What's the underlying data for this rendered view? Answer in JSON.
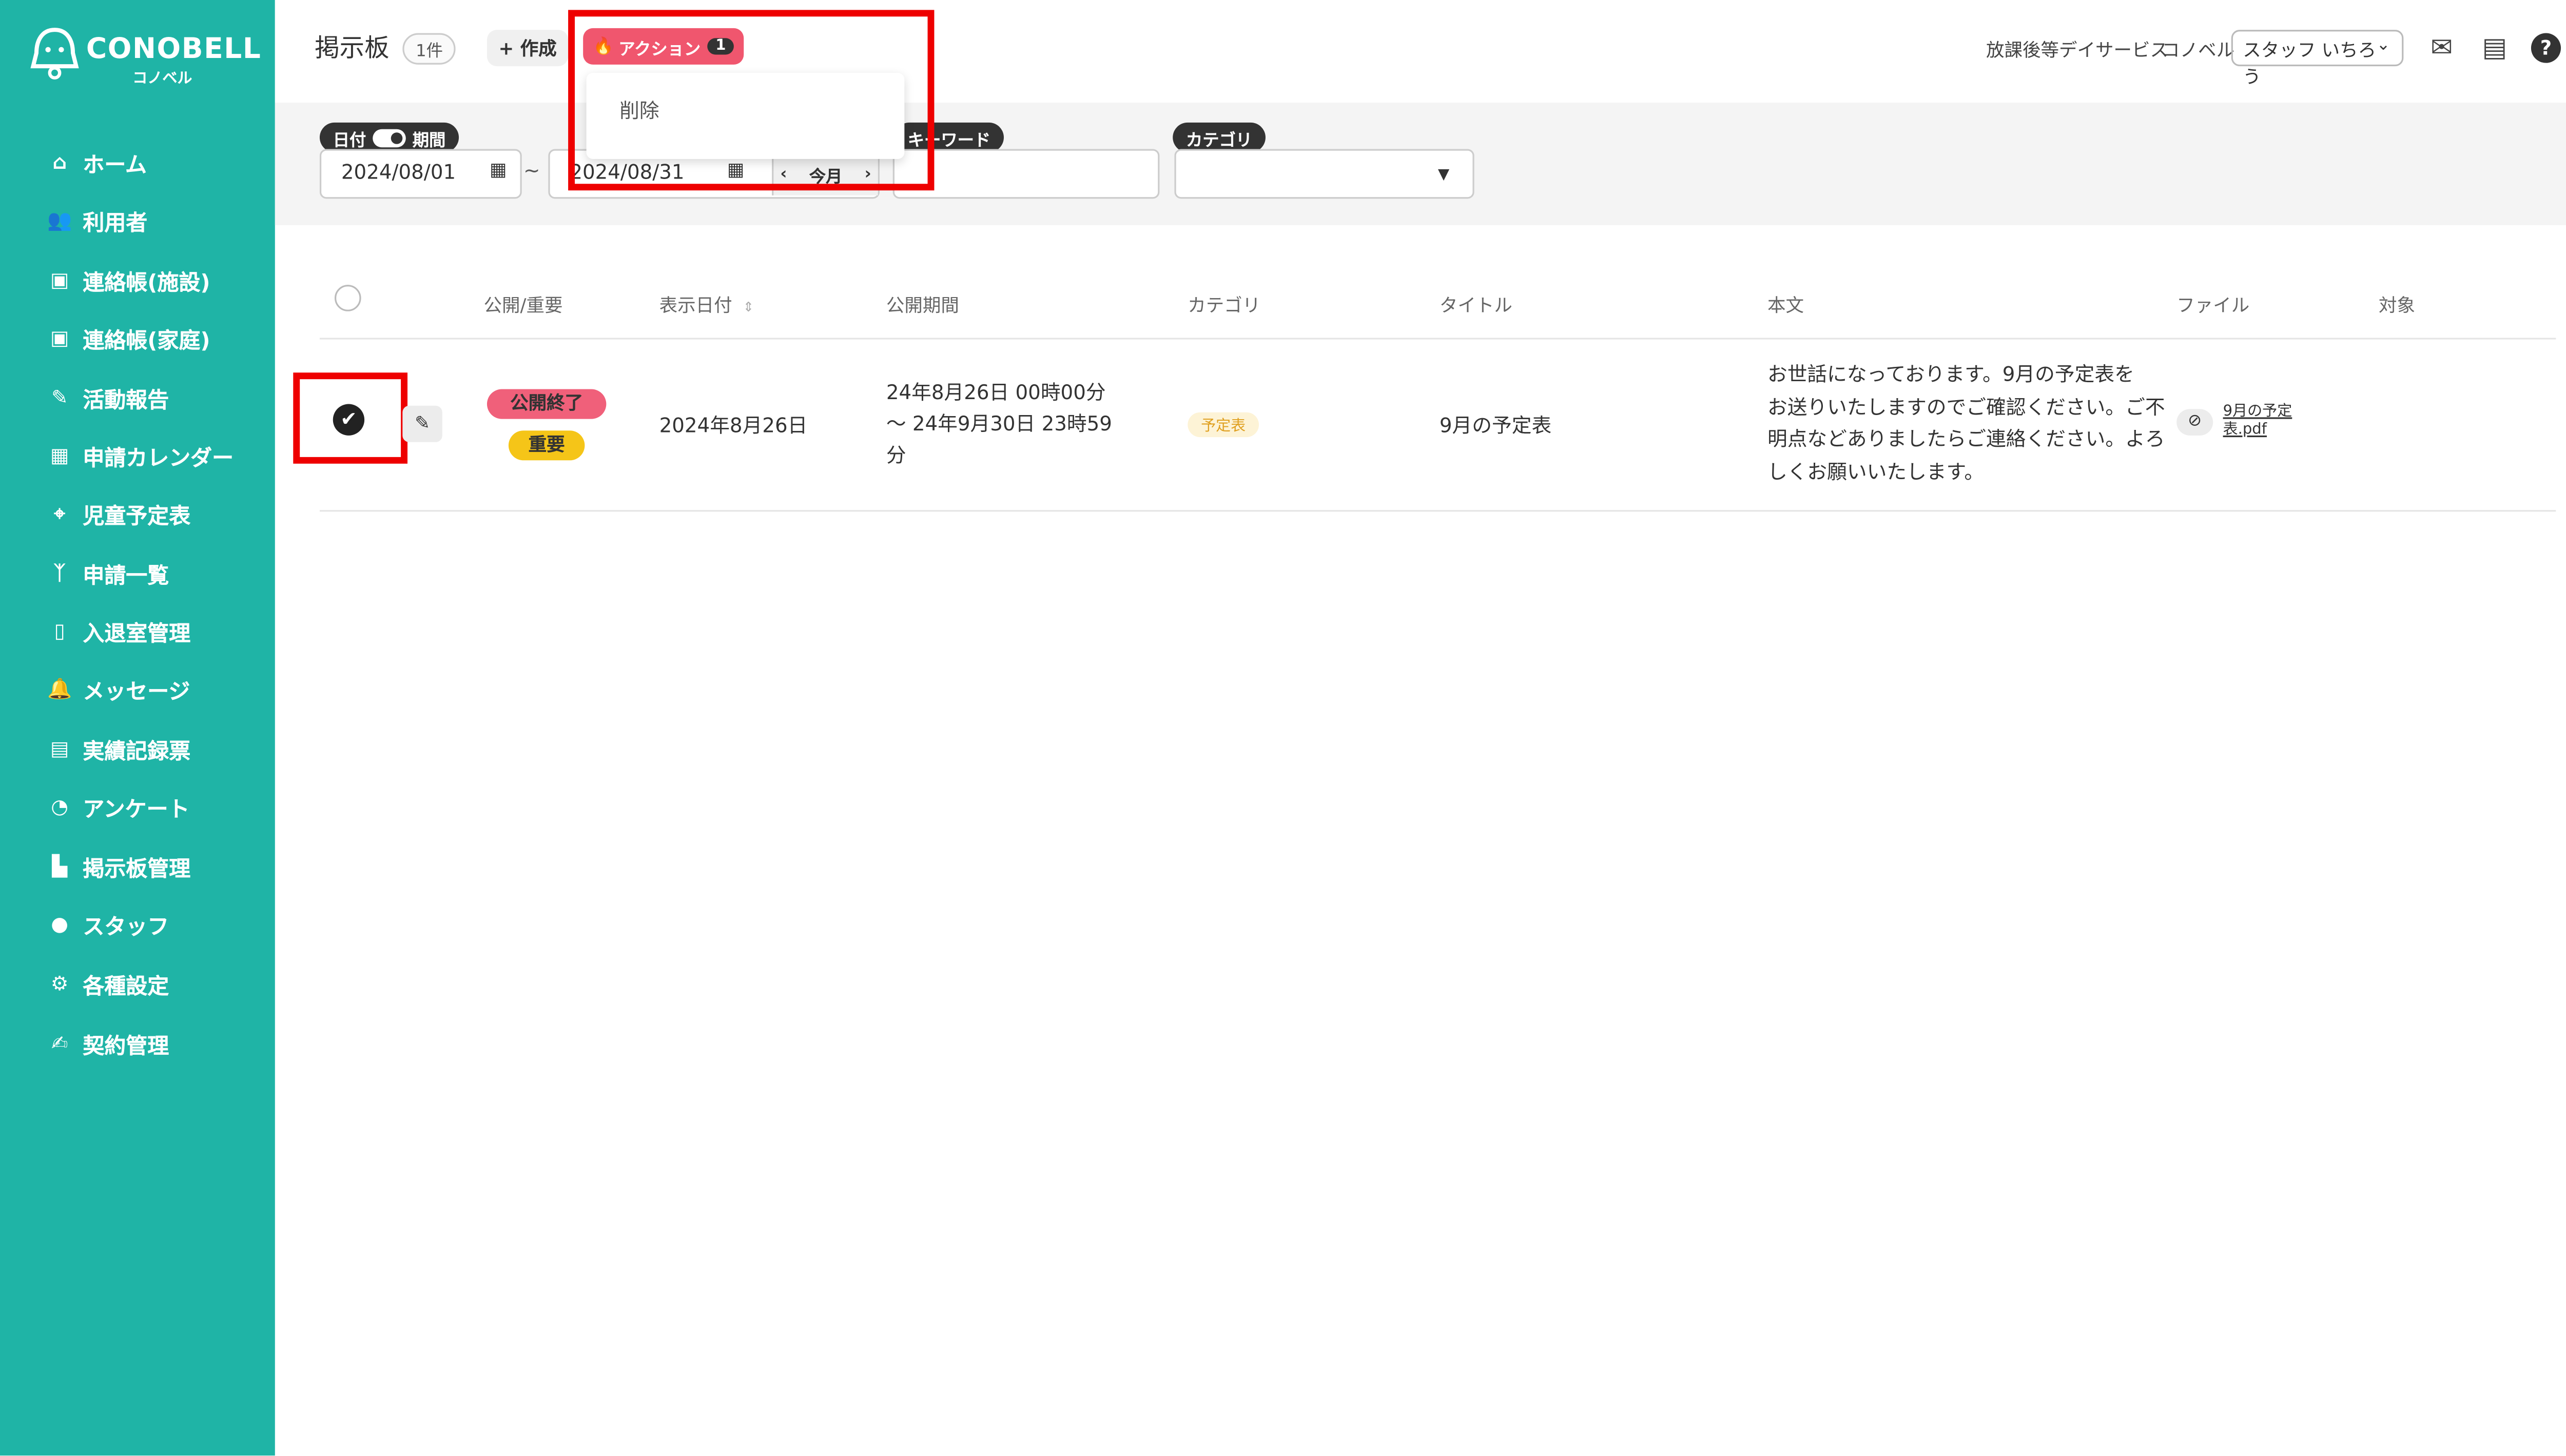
{
  "app": {
    "logo_text": "CONOBELL",
    "logo_sub": "コノベル"
  },
  "sidebar": {
    "items": [
      {
        "label": "ホーム",
        "icon": "home-icon"
      },
      {
        "label": "利用者",
        "icon": "users-icon"
      },
      {
        "label": "連絡帳(施設)",
        "icon": "notebook-icon"
      },
      {
        "label": "連絡帳(家庭)",
        "icon": "notebook-icon"
      },
      {
        "label": "活動報告",
        "icon": "report-icon"
      },
      {
        "label": "申請カレンダー",
        "icon": "calendar-icon"
      },
      {
        "label": "児童予定表",
        "icon": "schedule-icon"
      },
      {
        "label": "申請一覧",
        "icon": "person-icon"
      },
      {
        "label": "入退室管理",
        "icon": "tablet-icon"
      },
      {
        "label": "メッセージ",
        "icon": "bell-icon"
      },
      {
        "label": "実績記録票",
        "icon": "table-icon"
      },
      {
        "label": "アンケート",
        "icon": "pie-chart-icon"
      },
      {
        "label": "掲示板管理",
        "icon": "board-icon"
      },
      {
        "label": "スタッフ",
        "icon": "staff-icon"
      },
      {
        "label": "各種設定",
        "icon": "gear-icon"
      },
      {
        "label": "契約管理",
        "icon": "contract-icon"
      }
    ]
  },
  "header": {
    "title": "掲示板",
    "count": "1件",
    "create_label": "+ 作成",
    "action_label": "アクション",
    "action_badge": "1",
    "service_name": "放課後等デイサービス",
    "facility_name": "コノベル",
    "staff_name": "スタッフ いちろう"
  },
  "dropdown": {
    "items": [
      "削除"
    ]
  },
  "filters": {
    "date_label": "日付",
    "period_label": "期間",
    "date_from": "2024/08/01",
    "tilde": "~",
    "date_to": "2024/08/31",
    "this_month": "今月",
    "keyword_label": "キーワード",
    "keyword_value": "",
    "category_label": "カテゴリ",
    "category_value": ""
  },
  "table": {
    "headers": [
      "公開/重要",
      "表示日付",
      "公開期間",
      "カテゴリ",
      "タイトル",
      "本文",
      "ファイル",
      "対象"
    ],
    "rows": [
      {
        "status": "公開終了",
        "important": "重要",
        "display_date": "2024年8月26日",
        "period_line1": "24年8月26日 00時00分",
        "period_line2": "～ 24年9月30日 23時59",
        "period_line3": "分",
        "category": "予定表",
        "title": "9月の予定表",
        "body_line1": "お世話になっております。9月の予定表を",
        "body_line2": "お送りいたしますのでご確認ください。ご不",
        "body_line3": "明点などありましたらご連絡ください。よろ",
        "body_line4": "しくお願いいたします。",
        "file_name": "9月の予定表.pdf",
        "target": ""
      }
    ]
  },
  "colors": {
    "sidebar": "#1fb4a6",
    "action": "#f0566e",
    "highlight": "#e00000",
    "important": "#f5c518"
  }
}
